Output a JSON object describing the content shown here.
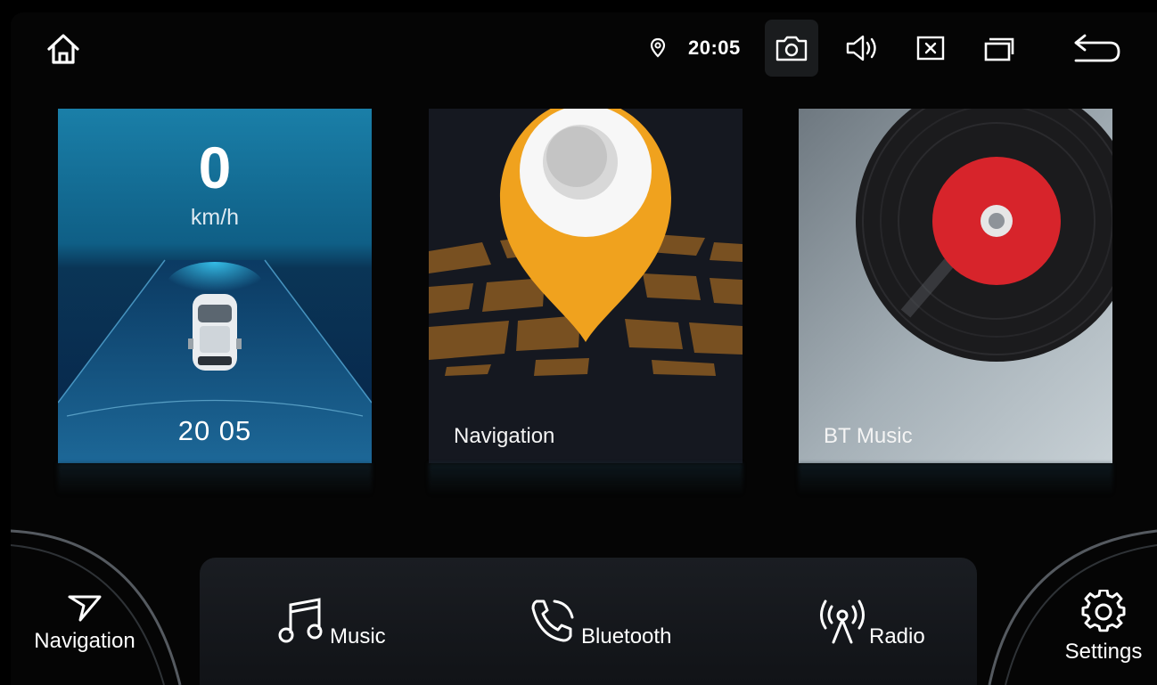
{
  "status_bar": {
    "clock": "20:05",
    "icons": [
      "home-icon",
      "location-pin-icon",
      "screenshot-icon",
      "volume-icon",
      "close-window-icon",
      "recent-apps-icon",
      "back-icon"
    ]
  },
  "cards": {
    "speed": {
      "value": "0",
      "unit": "km/h",
      "time": "20 05"
    },
    "navigation": {
      "label": "Navigation"
    },
    "bt_music": {
      "label": "BT Music"
    }
  },
  "dock": {
    "navigation": "Navigation",
    "music": "Music",
    "bluetooth": "Bluetooth",
    "radio": "Radio",
    "settings": "Settings"
  },
  "colors": {
    "speed_card": "#0f5f86",
    "nav_pin": "#f0a21e",
    "record_label": "#d7242b"
  }
}
